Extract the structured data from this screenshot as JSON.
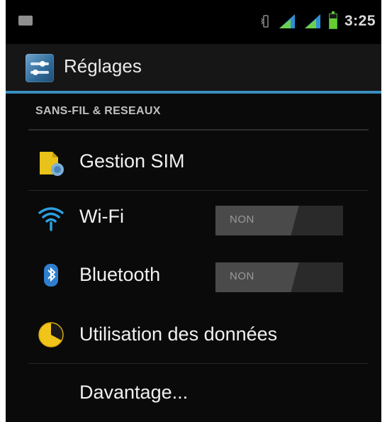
{
  "status_bar": {
    "time": "3:25",
    "icons": [
      "notification-icon",
      "vibrate-icon",
      "signal-icon",
      "signal-icon",
      "battery-icon"
    ]
  },
  "action_bar": {
    "title": "Réglages",
    "icon": "settings-icon"
  },
  "section": {
    "header": "SANS-FIL & RESEAUX"
  },
  "items": [
    {
      "label": "Gestion SIM",
      "icon": "sim-card-icon"
    },
    {
      "label": "Wi-Fi",
      "icon": "wifi-icon",
      "toggle": "NON"
    },
    {
      "label": "Bluetooth",
      "icon": "bluetooth-icon",
      "toggle": "NON"
    },
    {
      "label": "Utilisation des données",
      "icon": "data-usage-icon"
    },
    {
      "label": "Davantage..."
    }
  ],
  "colors": {
    "accent": "#3a8ebf",
    "background": "#0a0a0a",
    "signal": "#2e8fd6",
    "battery": "#66cc33"
  }
}
